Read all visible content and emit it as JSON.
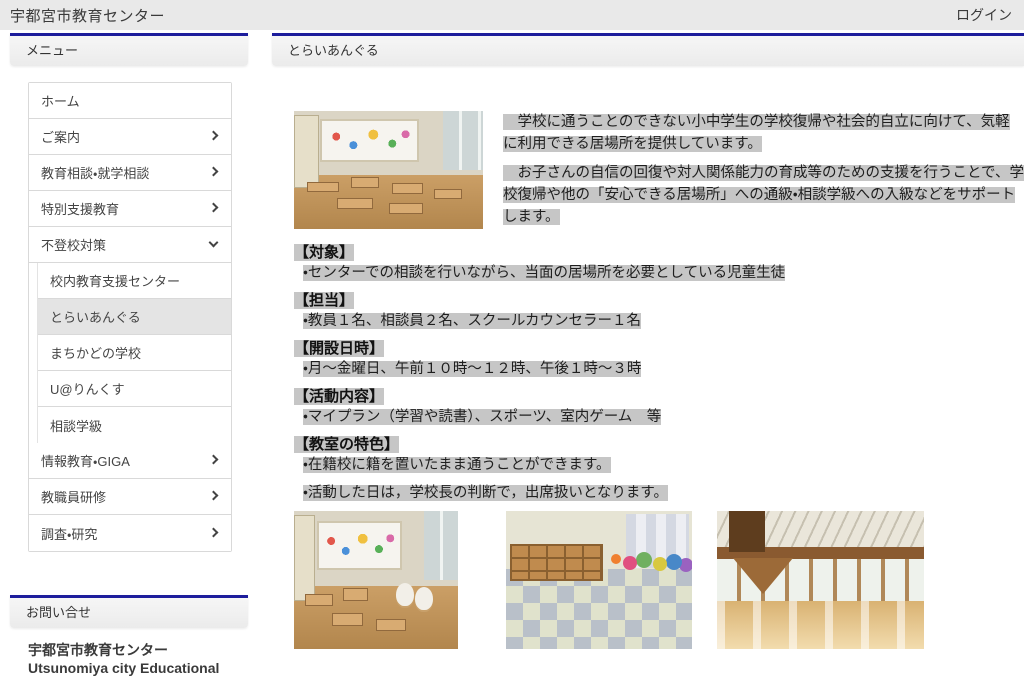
{
  "site": {
    "title": "宇都宮市教育センター",
    "login_label": "ログイン"
  },
  "colors": {
    "accent_blue": "#1d1d9c",
    "highlight_grey": "#c6c6c6",
    "header_grey": "#e9e9e9"
  },
  "sidebar": {
    "menu_title": "メニュー",
    "items_top": [
      {
        "label": "ホーム",
        "chevron": "none"
      },
      {
        "label": "ご案内",
        "chevron": "right"
      },
      {
        "label": "教育相談・就学相談",
        "chevron": "right"
      },
      {
        "label": "特別支援教育",
        "chevron": "right"
      },
      {
        "label": "不登校対策",
        "chevron": "down"
      }
    ],
    "submenu": [
      {
        "label": "校内教育支援センター",
        "active": false
      },
      {
        "label": "とらいあんぐる",
        "active": true
      },
      {
        "label": "まちかどの学校",
        "active": false
      },
      {
        "label": "U@りんくす",
        "active": false
      },
      {
        "label": "相談学級",
        "active": false
      }
    ],
    "items_bottom": [
      {
        "label": "情報教育・GIGA",
        "chevron": "right"
      },
      {
        "label": "教職員研修",
        "chevron": "right"
      },
      {
        "label": "調査・研究",
        "chevron": "right"
      }
    ],
    "contact_title": "お問い合せ",
    "footer_ja": "宇都宮市教育センター",
    "footer_en": "Utsunomiya city Educational"
  },
  "main": {
    "page_title": "とらいあんぐる",
    "intro": [
      "　学校に通うことのできない小中学生の学校復帰や社会的自立に向けて、気軽に利用できる居場所を提供しています。",
      "　お子さんの自信の回復や対人関係能力の育成等のための支援を行うことで、学校復帰や他の「安心できる居場所」への通級・相談学級への入級などをサポートします。"
    ],
    "sections": [
      {
        "heading": "【対象】",
        "items": [
          "・センターでの相談を行いながら、当面の居場所を必要としている児童生徒"
        ]
      },
      {
        "heading": "【担当】",
        "items": [
          "・教員１名、相談員２名、スクールカウンセラー１名"
        ]
      },
      {
        "heading": "【開設日時】",
        "items": [
          "・月～金曜日、午前１０時～１２時、午後１時～３時"
        ]
      },
      {
        "heading": "【活動内容】",
        "items": [
          "・マイプラン（学習や読書）、スポーツ、室内ゲーム　等"
        ]
      },
      {
        "heading": "【教室の特色】",
        "items": [
          "・在籍校に籍を置いたまま通うことができます。",
          "・活動した日は，学校長の判断で，出席扱いとなります。"
        ]
      }
    ]
  }
}
